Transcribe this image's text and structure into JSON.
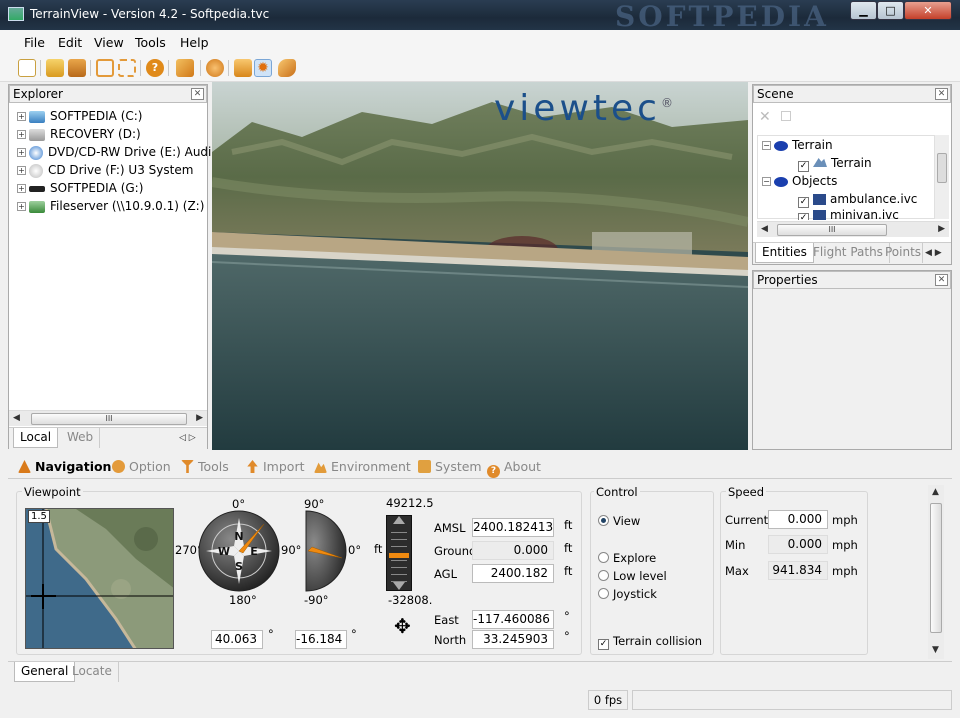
{
  "window": {
    "title": "TerrainView - Version 4.2 - Softpedia.tvc",
    "watermark": "SOFTPEDIA",
    "min": "▁",
    "max": "□",
    "close": "✕"
  },
  "menu": [
    "File",
    "Edit",
    "View",
    "Tools",
    "Help"
  ],
  "explorer": {
    "title": "Explorer",
    "drives": [
      {
        "label": "SOFTPEDIA (C:)",
        "icon": "windows-drive-icon"
      },
      {
        "label": "RECOVERY (D:)",
        "icon": "hard-drive-icon"
      },
      {
        "label": "DVD/CD-RW Drive (E:) Audio CD",
        "icon": "cd-audio-icon"
      },
      {
        "label": "CD Drive (F:) U3 System",
        "icon": "cd-drive-icon"
      },
      {
        "label": "SOFTPEDIA (G:)",
        "icon": "removable-drive-icon"
      },
      {
        "label": "Fileserver (\\\\10.9.0.1) (Z:)",
        "icon": "network-drive-icon"
      }
    ],
    "tabs": [
      "Local",
      "Web"
    ],
    "active_tab": "Local"
  },
  "viewport": {
    "logo": "viewtec",
    "logo_mark": "®"
  },
  "scene": {
    "title": "Scene",
    "tree": [
      {
        "label": "Terrain",
        "level": 0
      },
      {
        "label": "Terrain",
        "level": 1
      },
      {
        "label": "Objects",
        "level": 0
      },
      {
        "label": "ambulance.ivc",
        "level": 1
      },
      {
        "label": "minivan.ivc",
        "level": 1
      }
    ],
    "tabs": [
      "Entities",
      "Flight Paths",
      "Points"
    ],
    "active_tab": "Entities"
  },
  "properties": {
    "title": "Properties"
  },
  "bottom": {
    "tabs": [
      "Navigation",
      "Option",
      "Tools",
      "Import",
      "Environment",
      "System",
      "About"
    ],
    "active_tab": "Navigation",
    "tab_colors": [
      "#d97a1a",
      "#e39a3a",
      "#e08a2a",
      "#e08a2a",
      "#e29b3a",
      "#e0a040",
      "#e08a2a"
    ],
    "viewpoint": {
      "label": "Viewpoint",
      "zoom": "1.5",
      "compass": {
        "n": "0°",
        "e": "90°",
        "s": "180°",
        "w": "270°",
        "value": "40.063",
        "unit": "°",
        "heading_deg": 40
      },
      "pitch": {
        "top": "90°",
        "right": "0°",
        "bottom": "-90°",
        "value": "-16.184",
        "unit": "°",
        "pitch_deg": -16
      },
      "altitude": {
        "max": "49212.5",
        "min": "-32808.",
        "unit": "ft",
        "level": 0.52
      },
      "rows": [
        {
          "label": "AMSL",
          "value": "2400.182413",
          "unit": "ft",
          "readonly": false
        },
        {
          "label": "Ground",
          "value": "0.000",
          "unit": "ft",
          "readonly": true
        },
        {
          "label": "AGL",
          "value": "2400.182",
          "unit": "ft",
          "readonly": false
        },
        {
          "label": "East",
          "value": "-117.460086",
          "unit": "°",
          "readonly": false
        },
        {
          "label": "North",
          "value": "33.245903",
          "unit": "°",
          "readonly": false
        }
      ]
    },
    "control": {
      "label": "Control",
      "view": "View",
      "options": [
        "Explore",
        "Low level",
        "Joystick"
      ],
      "collision": "Terrain collision"
    },
    "speed": {
      "label": "Speed",
      "rows": [
        {
          "label": "Current",
          "value": "0.000",
          "unit": "mph",
          "readonly": false
        },
        {
          "label": "Min",
          "value": "0.000",
          "unit": "mph",
          "readonly": true
        },
        {
          "label": "Max",
          "value": "941.834",
          "unit": "mph",
          "readonly": true
        }
      ]
    },
    "subtabs": [
      "General",
      "Locate"
    ],
    "active_subtab": "General"
  },
  "status": {
    "fps": "0 fps"
  }
}
